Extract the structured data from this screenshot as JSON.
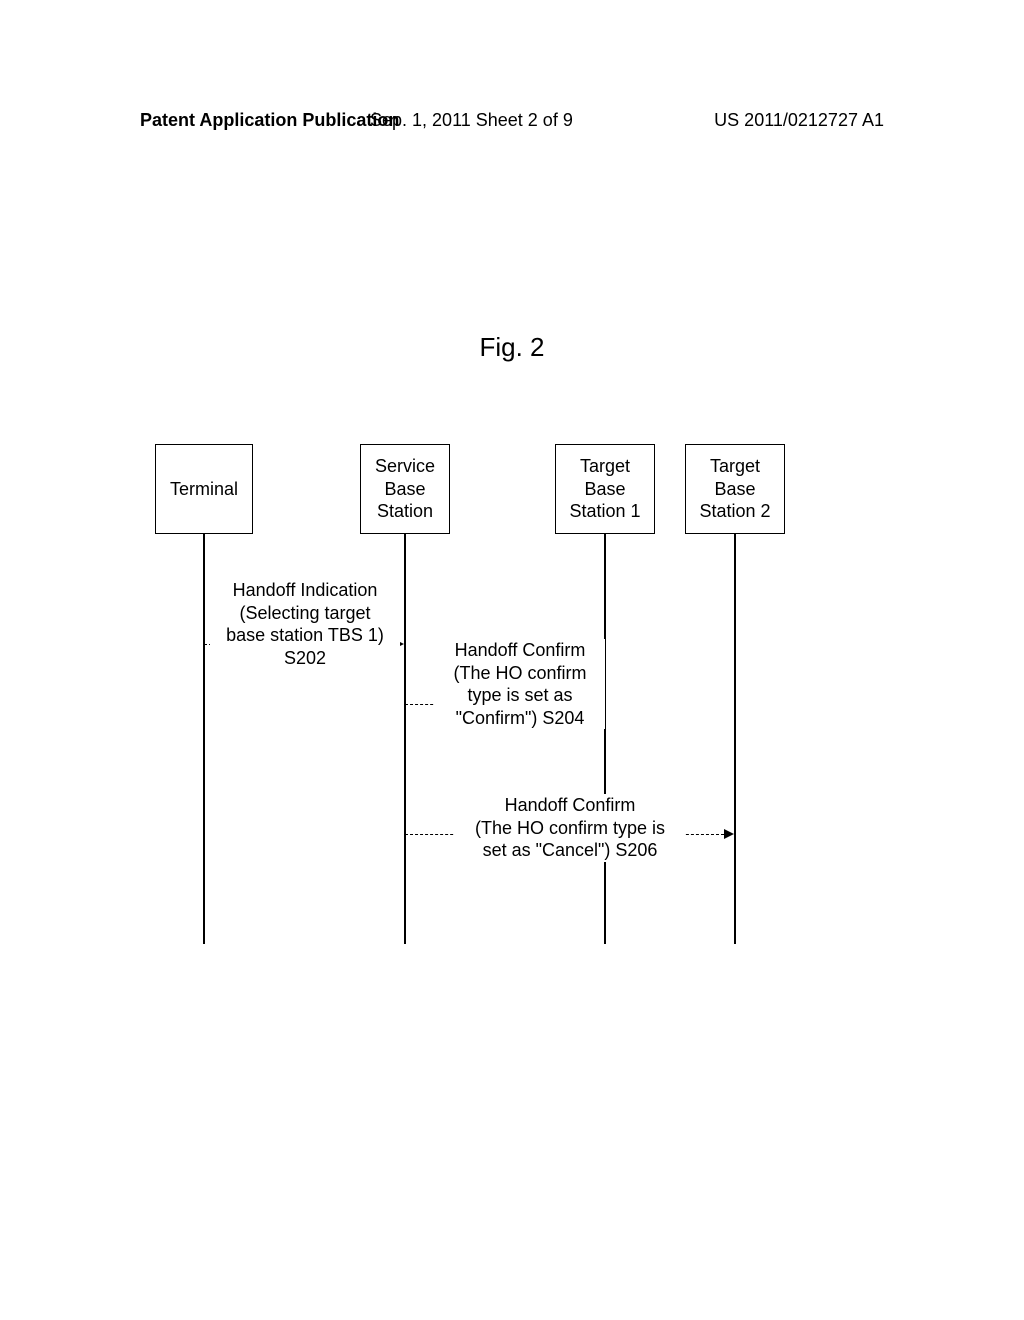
{
  "header": {
    "left": "Patent Application Publication",
    "mid": "Sep. 1, 2011  Sheet 2 of 9",
    "right": "US 2011/0212727 A1"
  },
  "figure": {
    "title": "Fig. 2"
  },
  "lifelines": {
    "terminal": "Terminal",
    "sbs": "Service\nBase\nStation",
    "tbs1": "Target\nBase\nStation 1",
    "tbs2": "Target\nBase\nStation 2"
  },
  "messages": {
    "m1": "Handoff Indication\n(Selecting target\nbase station TBS 1)\nS202",
    "m2": "Handoff Confirm\n(The HO confirm\ntype is set as\n\"Confirm\") S204",
    "m3": "Handoff Confirm\n(The HO confirm type is\nset as \"Cancel\") S206"
  }
}
